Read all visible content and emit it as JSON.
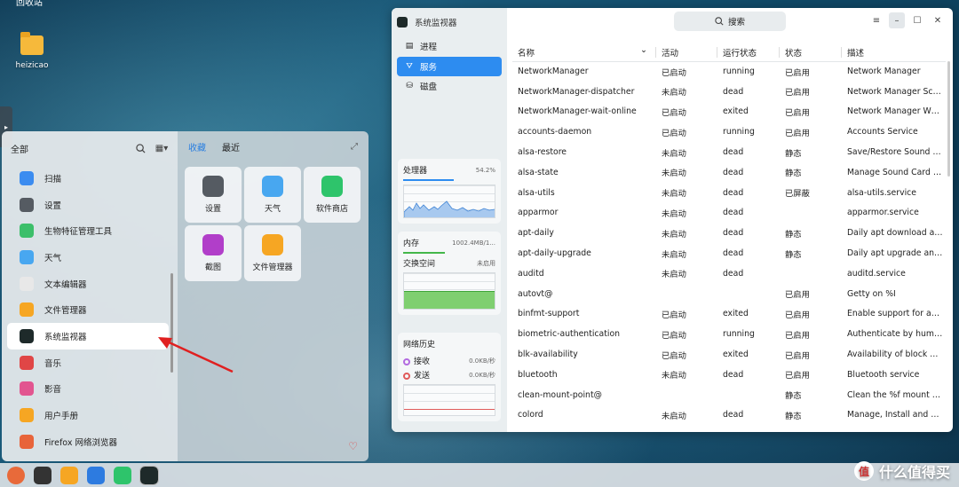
{
  "desktop": {
    "top_label": "回收站",
    "folder_label": "heizicao"
  },
  "launcher": {
    "header_label": "全部",
    "apps": [
      {
        "label": "扫描",
        "icon": "scanner-icon",
        "color": "#3b8cf0"
      },
      {
        "label": "设置",
        "icon": "gear-icon",
        "color": "#555b62"
      },
      {
        "label": "生物特征管理工具",
        "icon": "fingerprint-icon",
        "color": "#3cbf6a"
      },
      {
        "label": "天气",
        "icon": "weather-icon",
        "color": "#48a7f0"
      },
      {
        "label": "文本编辑器",
        "icon": "text-editor-icon",
        "color": "#e8e8e8"
      },
      {
        "label": "文件管理器",
        "icon": "folder-icon",
        "color": "#f6a623"
      },
      {
        "label": "系统监视器",
        "icon": "monitor-icon",
        "color": "#1e2a2a"
      },
      {
        "label": "音乐",
        "icon": "music-icon",
        "color": "#e04646"
      },
      {
        "label": "影音",
        "icon": "video-icon",
        "color": "#e25590"
      },
      {
        "label": "用户手册",
        "icon": "manual-icon",
        "color": "#f6a623"
      },
      {
        "label": "Firefox 网络浏览器",
        "icon": "firefox-icon",
        "color": "#e8643a"
      }
    ],
    "tabs": [
      "收藏",
      "最近"
    ],
    "favorites": [
      {
        "label": "设置",
        "icon": "gear-icon",
        "color": "#555b62"
      },
      {
        "label": "天气",
        "icon": "weather-icon",
        "color": "#48a7f0"
      },
      {
        "label": "软件商店",
        "icon": "store-icon",
        "color": "#2ec46b"
      },
      {
        "label": "截图",
        "icon": "screenshot-icon",
        "color": "#b13ec9"
      },
      {
        "label": "文件管理器",
        "icon": "folder-icon",
        "color": "#f6a623"
      }
    ]
  },
  "monitor": {
    "title": "系统监视器",
    "nav": [
      {
        "label": "进程",
        "icon": "process-icon"
      },
      {
        "label": "服务",
        "icon": "service-icon"
      },
      {
        "label": "磁盘",
        "icon": "disk-icon"
      }
    ],
    "cpu": {
      "label": "处理器",
      "value": "54.2%",
      "fraction": 0.542
    },
    "memory": {
      "label": "内存",
      "value": "1002.4MB/1...",
      "swap_label": "交换空间",
      "swap_value": "未启用"
    },
    "network": {
      "label": "网络历史",
      "recv_label": "接收",
      "recv_value": "0.0KB/秒",
      "send_label": "发送",
      "send_value": "0.0KB/秒",
      "recv_color": "#b36be0",
      "send_color": "#e05a5a"
    },
    "search_placeholder": "搜索",
    "columns": [
      "名称",
      "活动",
      "运行状态",
      "状态",
      "描述"
    ],
    "rows": [
      [
        "NetworkManager",
        "已启动",
        "running",
        "已启用",
        "Network Manager"
      ],
      [
        "NetworkManager-dispatcher",
        "未启动",
        "dead",
        "已启用",
        "Network Manager Sc…"
      ],
      [
        "NetworkManager-wait-online",
        "已启动",
        "exited",
        "已启用",
        "Network Manager W…"
      ],
      [
        "accounts-daemon",
        "已启动",
        "running",
        "已启用",
        "Accounts Service"
      ],
      [
        "alsa-restore",
        "未启动",
        "dead",
        "静态",
        "Save/Restore Sound …"
      ],
      [
        "alsa-state",
        "未启动",
        "dead",
        "静态",
        "Manage Sound Card …"
      ],
      [
        "alsa-utils",
        "未启动",
        "dead",
        "已屏蔽",
        "alsa-utils.service"
      ],
      [
        "apparmor",
        "未启动",
        "dead",
        "",
        "apparmor.service"
      ],
      [
        "apt-daily",
        "未启动",
        "dead",
        "静态",
        "Daily apt download a…"
      ],
      [
        "apt-daily-upgrade",
        "未启动",
        "dead",
        "静态",
        "Daily apt upgrade an…"
      ],
      [
        "auditd",
        "未启动",
        "dead",
        "",
        "auditd.service"
      ],
      [
        "autovt@",
        "",
        "",
        "已启用",
        "Getty on %I"
      ],
      [
        "binfmt-support",
        "已启动",
        "exited",
        "已启用",
        "Enable support for a…"
      ],
      [
        "biometric-authentication",
        "已启动",
        "running",
        "已启用",
        "Authenticate by hum…"
      ],
      [
        "blk-availability",
        "已启动",
        "exited",
        "已启用",
        "Availability of block …"
      ],
      [
        "bluetooth",
        "未启动",
        "dead",
        "已启用",
        "Bluetooth service"
      ],
      [
        "clean-mount-point@",
        "",
        "",
        "静态",
        "Clean the %f mount …"
      ],
      [
        "colord",
        "未启动",
        "dead",
        "静态",
        "Manage, Install and …"
      ]
    ]
  },
  "taskbar": [
    {
      "icon": "launcher-icon",
      "color": "#e86a3a"
    },
    {
      "icon": "multitask-icon",
      "color": "#333"
    },
    {
      "icon": "folder-icon",
      "color": "#f6a623"
    },
    {
      "icon": "wps-icon",
      "color": "#2d7be0"
    },
    {
      "icon": "store-icon",
      "color": "#2ec46b"
    },
    {
      "icon": "monitor-icon",
      "color": "#1e2a2a"
    }
  ],
  "watermark": "什么值得买"
}
